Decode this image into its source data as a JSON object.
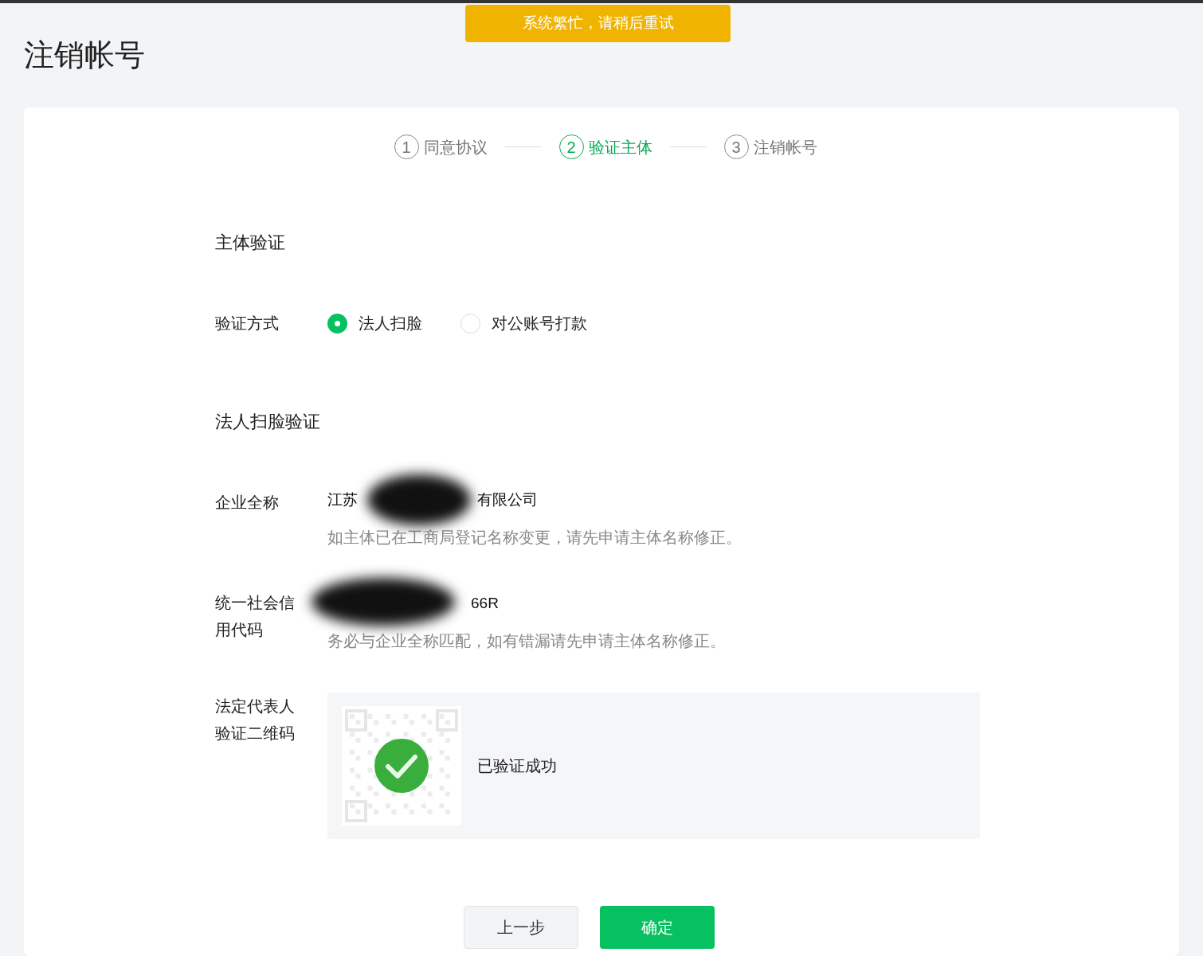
{
  "toast": {
    "text": "系统繁忙，请稍后重试"
  },
  "page_title": "注销帐号",
  "steps": [
    {
      "number": "1",
      "label": "同意协议",
      "selected": false
    },
    {
      "number": "2",
      "label": "验证主体",
      "selected": true
    },
    {
      "number": "3",
      "label": "注销帐号",
      "selected": false
    }
  ],
  "section_title": "主体验证",
  "verify_method": {
    "label": "验证方式",
    "options": [
      {
        "label": "法人扫脸",
        "selected": true
      },
      {
        "label": "对公账号打款",
        "selected": false
      }
    ]
  },
  "subsection_title": "法人扫脸验证",
  "company_name": {
    "label": "企业全称",
    "value_fragments": [
      "江苏",
      "有限公司"
    ],
    "hint": "如主体已在工商局登记名称变更，请先申请主体名称修正。"
  },
  "credit_code": {
    "label": "统一社会信用代码",
    "value_fragments": [
      "66R"
    ],
    "hint": "务必与企业全称匹配，如有错漏请先申请主体名称修正。"
  },
  "qr_verify": {
    "label": "法定代表人验证二维码",
    "verified": true,
    "status": "已验证成功"
  },
  "buttons": [
    {
      "label": "上一步",
      "kind": "secondary"
    },
    {
      "label": "确定",
      "kind": "primary"
    }
  ]
}
